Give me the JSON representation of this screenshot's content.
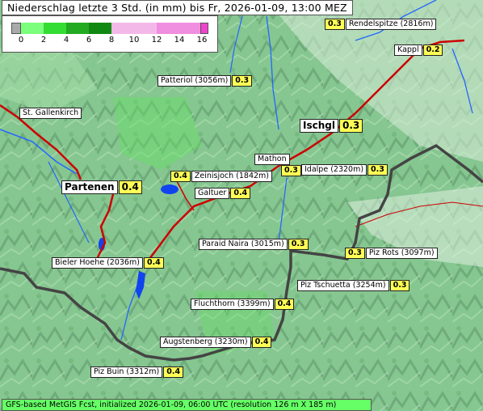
{
  "title": "Niederschlag letzte 3 Std. (in mm) bis Fr, 2026-01-09, 13:00 MEZ",
  "legend": {
    "ticks": [
      "0",
      "2",
      "4",
      "6",
      "8",
      "10",
      "12",
      "14",
      "16"
    ],
    "colors": {
      "below": "#aaaaaa",
      "light_green": "#7cff7c",
      "green": "#22cc22",
      "dark_green": "#118811",
      "pink": "#f4b8e8",
      "magenta": "#ee44cc"
    }
  },
  "places": [
    {
      "name": "Rendelspitze (2816m)",
      "value": "0.3",
      "value_first": true
    },
    {
      "name": "Kappl",
      "value": "0.2"
    },
    {
      "name": "Patteriol (3056m)",
      "value": "0.3"
    },
    {
      "name": "St. Gallenkirch",
      "value": ""
    },
    {
      "name": "Ischgl",
      "value": "0.3",
      "big": true
    },
    {
      "name": "Mathon",
      "value": ""
    },
    {
      "name": "",
      "value": "0.3"
    },
    {
      "name": "Idalpe (2320m)",
      "value": "0.3"
    },
    {
      "name": "Zeinisjoch (1842m)",
      "value": "0.4",
      "value_first": true
    },
    {
      "name": "Partenen",
      "value": "0.4",
      "big": true
    },
    {
      "name": "Galtuer",
      "value": "0.4"
    },
    {
      "name": "Paraid Naira (3015m)",
      "value": "0.3"
    },
    {
      "name": "Piz Rots (3097m)",
      "value": "0.3",
      "value_first": true
    },
    {
      "name": "Bieler Hoehe (2036m)",
      "value": "0.4"
    },
    {
      "name": "Piz Tschuetta (3254m)",
      "value": "0.3"
    },
    {
      "name": "Fluchthorn (3399m)",
      "value": "0.4"
    },
    {
      "name": "Augstenberg (3230m)",
      "value": "0.4"
    },
    {
      "name": "Piz Buin (3312m)",
      "value": "0.4"
    }
  ],
  "footer": "GFS-based MetGIS Fcst, initialized 2026-01-09, 06:00 UTC  (resolution 126 m X 185 m)"
}
